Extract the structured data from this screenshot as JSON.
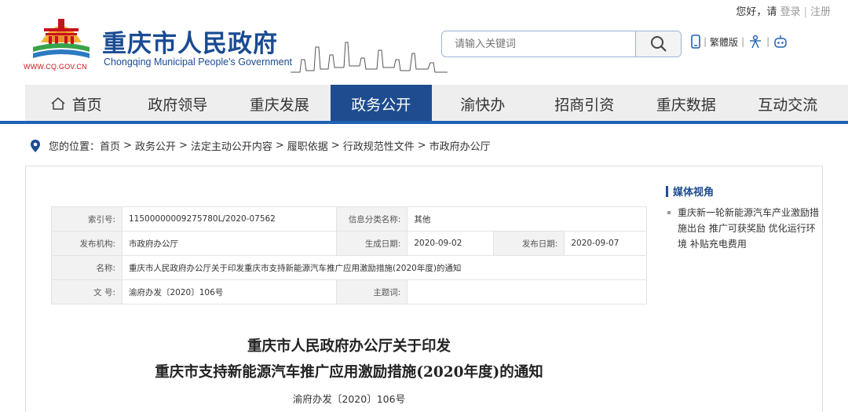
{
  "userbar": {
    "greeting": "您好，请",
    "login": "登录",
    "register": "注册"
  },
  "logo": {
    "title_cn": "重庆市人民政府",
    "title_en": "Chongqing Municipal People's Government",
    "url": "WWW.CQ.GOV.CN"
  },
  "search": {
    "placeholder": "请输入关键词"
  },
  "tools": {
    "traditional": "繁體版"
  },
  "nav": {
    "items": [
      {
        "label": "首页"
      },
      {
        "label": "政府领导"
      },
      {
        "label": "重庆发展"
      },
      {
        "label": "政务公开"
      },
      {
        "label": "渝快办"
      },
      {
        "label": "招商引资"
      },
      {
        "label": "重庆数据"
      },
      {
        "label": "互动交流"
      }
    ],
    "active_index": 3
  },
  "breadcrumb": {
    "prefix": "您的位置：",
    "items": [
      "首页",
      "政务公开",
      "法定主动公开内容",
      "履职依据",
      "行政规范性文件",
      "市政府办公厅"
    ]
  },
  "meta": {
    "index_no_label": "索引号:",
    "index_no": "11500000009275780L/2020-07562",
    "category_label": "信息分类名称:",
    "category": "其他",
    "publisher_label": "发布机构:",
    "publisher": "市政府办公厅",
    "created_label": "生成日期:",
    "created": "2020-09-02",
    "published_label": "发布日期:",
    "published": "2020-09-07",
    "name_label": "名称:",
    "name": "重庆市人民政府办公厅关于印发重庆市支持新能源汽车推广应用激励措施(2020年度)的通知",
    "docno_label": "文 号:",
    "docno": "渝府办发〔2020〕106号",
    "subject_label": "主题词:",
    "subject": ""
  },
  "sidebar": {
    "title": "媒体视角",
    "items": [
      {
        "text": "重庆新一轮新能源汽车产业激励措施出台 推广可获奖励 优化运行环境 补贴充电费用"
      }
    ]
  },
  "document": {
    "title_line1": "重庆市人民政府办公厅关于印发",
    "title_line2": "重庆市支持新能源汽车推广应用激励措施(2020年度)的通知",
    "doc_number": "渝府办发〔2020〕106号"
  },
  "colors": {
    "brand_blue": "#1e4c8f",
    "nav_line": "#1e61b4",
    "logo_red": "#c8111a"
  }
}
